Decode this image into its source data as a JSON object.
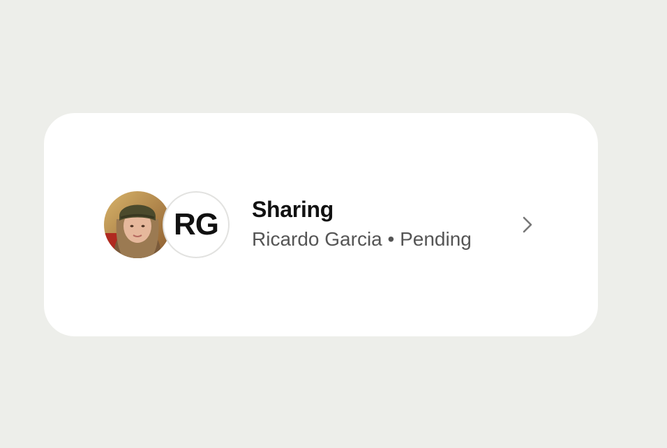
{
  "card": {
    "title": "Sharing",
    "subtitle": "Ricardo Garcia • Pending",
    "avatars": [
      {
        "type": "photo",
        "description_icon": "user-photo-avatar"
      },
      {
        "type": "initials",
        "initials": "RG"
      }
    ],
    "chevron_icon": "chevron-right-icon"
  },
  "colors": {
    "background": "#edeeea",
    "card": "#ffffff",
    "title": "#111111",
    "subtitle": "#555555",
    "chevron": "#777777"
  }
}
